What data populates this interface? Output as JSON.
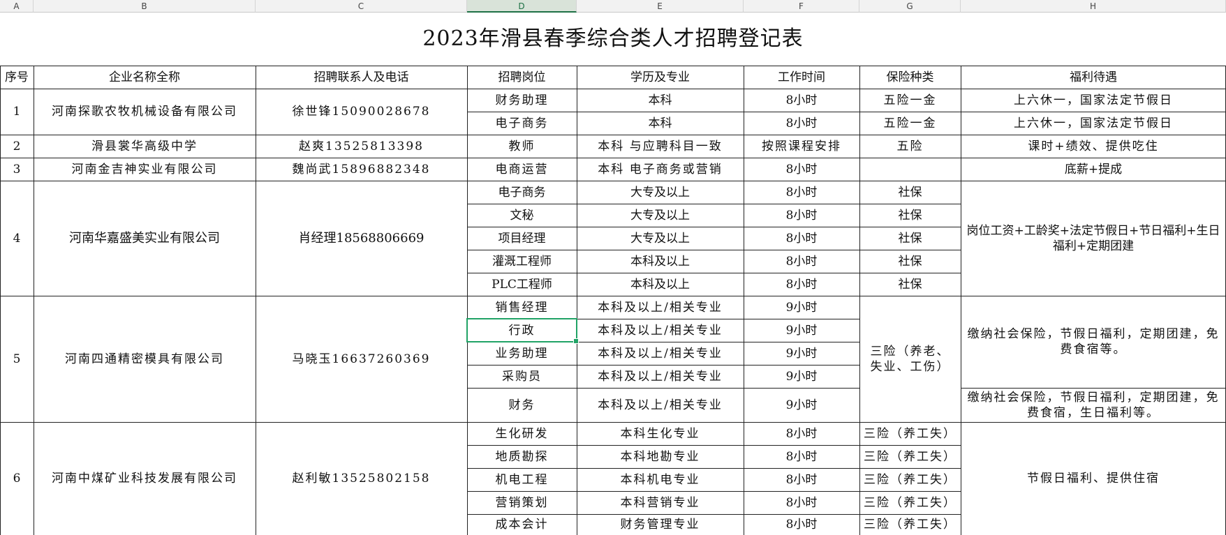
{
  "columns": [
    "A",
    "B",
    "C",
    "D",
    "E",
    "F",
    "G",
    "H"
  ],
  "selected_column": "D",
  "title": "2023年滑县春季综合类人才招聘登记表",
  "header": {
    "seq": "序号",
    "company": "企业名称全称",
    "contact": "招聘联系人及电话",
    "position": "招聘岗位",
    "education": "学历及专业",
    "hours": "工作时间",
    "insurance": "保险种类",
    "benefits": "福利待遇"
  },
  "companies": [
    {
      "seq": "1",
      "name": "河南探歌农牧机械设备有限公司",
      "contact": "徐世锋15090028678",
      "jobs": [
        {
          "position": "财务助理",
          "education": "本科",
          "hours": "8小时",
          "insurance": "五险一金",
          "benefits": "上六休一，国家法定节假日"
        },
        {
          "position": "电子商务",
          "education": "本科",
          "hours": "8小时",
          "insurance": "五险一金",
          "benefits": "上六休一，国家法定节假日"
        }
      ]
    },
    {
      "seq": "2",
      "name": "滑县裳华高级中学",
      "contact": "赵爽13525813398",
      "jobs": [
        {
          "position": "教师",
          "education": "本科 与应聘科目一致",
          "hours": "按照课程安排",
          "insurance": "五险",
          "benefits": "课时+绩效、提供吃住"
        }
      ]
    },
    {
      "seq": "3",
      "name": "河南金吉神实业有限公司",
      "contact": "魏尚武15896882348",
      "jobs": [
        {
          "position": "电商运营",
          "education": "本科 电子商务或营销",
          "hours": "8小时",
          "insurance": "",
          "benefits": "底薪+提成"
        }
      ]
    },
    {
      "seq": "4",
      "name": "河南华嘉盛美实业有限公司",
      "contact": "肖经理18568806669",
      "benefits": "岗位工资+工龄奖+法定节假日+节日福利+生日福利+定期团建",
      "jobs": [
        {
          "position": "电子商务",
          "education": "大专及以上",
          "hours": "8小时",
          "insurance": "社保"
        },
        {
          "position": "文秘",
          "education": "大专及以上",
          "hours": "8小时",
          "insurance": "社保"
        },
        {
          "position": "项目经理",
          "education": "大专及以上",
          "hours": "8小时",
          "insurance": "社保"
        },
        {
          "position": "灌溉工程师",
          "education": "本科及以上",
          "hours": "8小时",
          "insurance": "社保"
        },
        {
          "position": "PLC工程师",
          "education": "本科及以上",
          "hours": "8小时",
          "insurance": "社保"
        }
      ]
    },
    {
      "seq": "5",
      "name": "河南四通精密模具有限公司",
      "contact": "马晓玉16637260369",
      "insurance": "三险（养老、失业、工伤）",
      "benefits_a": "缴纳社会保险，节假日福利，定期团建，免费食宿等。",
      "benefits_b": "缴纳社会保险，节假日福利，定期团建，免费食宿，生日福利等。",
      "jobs": [
        {
          "position": "销售经理",
          "education": "本科及以上/相关专业",
          "hours": "9小时"
        },
        {
          "position": "行政",
          "education": "本科及以上/相关专业",
          "hours": "9小时"
        },
        {
          "position": "业务助理",
          "education": "本科及以上/相关专业",
          "hours": "9小时"
        },
        {
          "position": "采购员",
          "education": "本科及以上/相关专业",
          "hours": "9小时"
        },
        {
          "position": "财务",
          "education": "本科及以上/相关专业",
          "hours": "9小时"
        }
      ]
    },
    {
      "seq": "6",
      "name": "河南中煤矿业科技发展有限公司",
      "contact": "赵利敏13525802158",
      "benefits": "节假日福利、提供住宿",
      "jobs": [
        {
          "position": "生化研发",
          "education": "本科生化专业",
          "hours": "8小时",
          "insurance": "三险（养工失）"
        },
        {
          "position": "地质勘探",
          "education": "本科地勘专业",
          "hours": "8小时",
          "insurance": "三险（养工失）"
        },
        {
          "position": "机电工程",
          "education": "本科机电专业",
          "hours": "8小时",
          "insurance": "三险（养工失）"
        },
        {
          "position": "营销策划",
          "education": "本科营销专业",
          "hours": "8小时",
          "insurance": "三险（养工失）"
        },
        {
          "position": "成本会计",
          "education": "财务管理专业",
          "hours": "8小时",
          "insurance": "三险（养工失）"
        }
      ]
    }
  ]
}
